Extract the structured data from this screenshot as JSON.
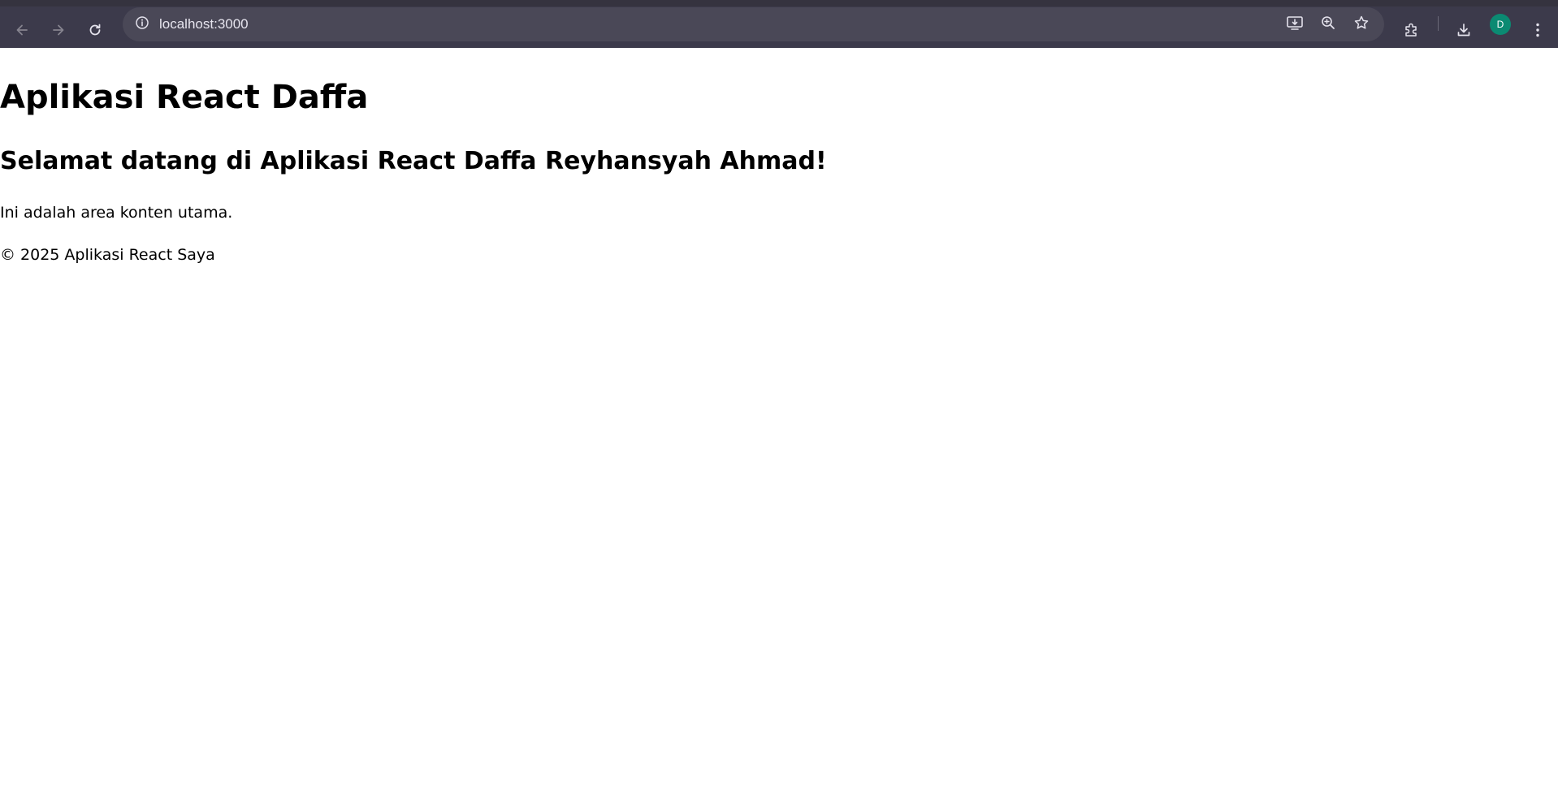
{
  "browser": {
    "url": "localhost:3000",
    "profile_initial": "D",
    "icons": {
      "back": "arrow-left-icon",
      "forward": "arrow-right-icon",
      "reload": "reload-icon",
      "site_info": "info-icon",
      "install": "install-app-icon",
      "zoom": "zoom-icon",
      "bookmark": "star-icon",
      "extensions": "puzzle-icon",
      "downloads": "download-icon",
      "menu": "kebab-menu-icon"
    },
    "colors": {
      "toolbar": "#3c3a4b",
      "omnibox": "#4a4857",
      "avatar": "#0b8a72"
    }
  },
  "page": {
    "title": "Aplikasi React Daffa",
    "welcome": "Selamat datang di Aplikasi React Daffa Reyhansyah Ahmad!",
    "main_text": "Ini adalah area konten utama.",
    "footer": "© 2025 Aplikasi React Saya"
  }
}
